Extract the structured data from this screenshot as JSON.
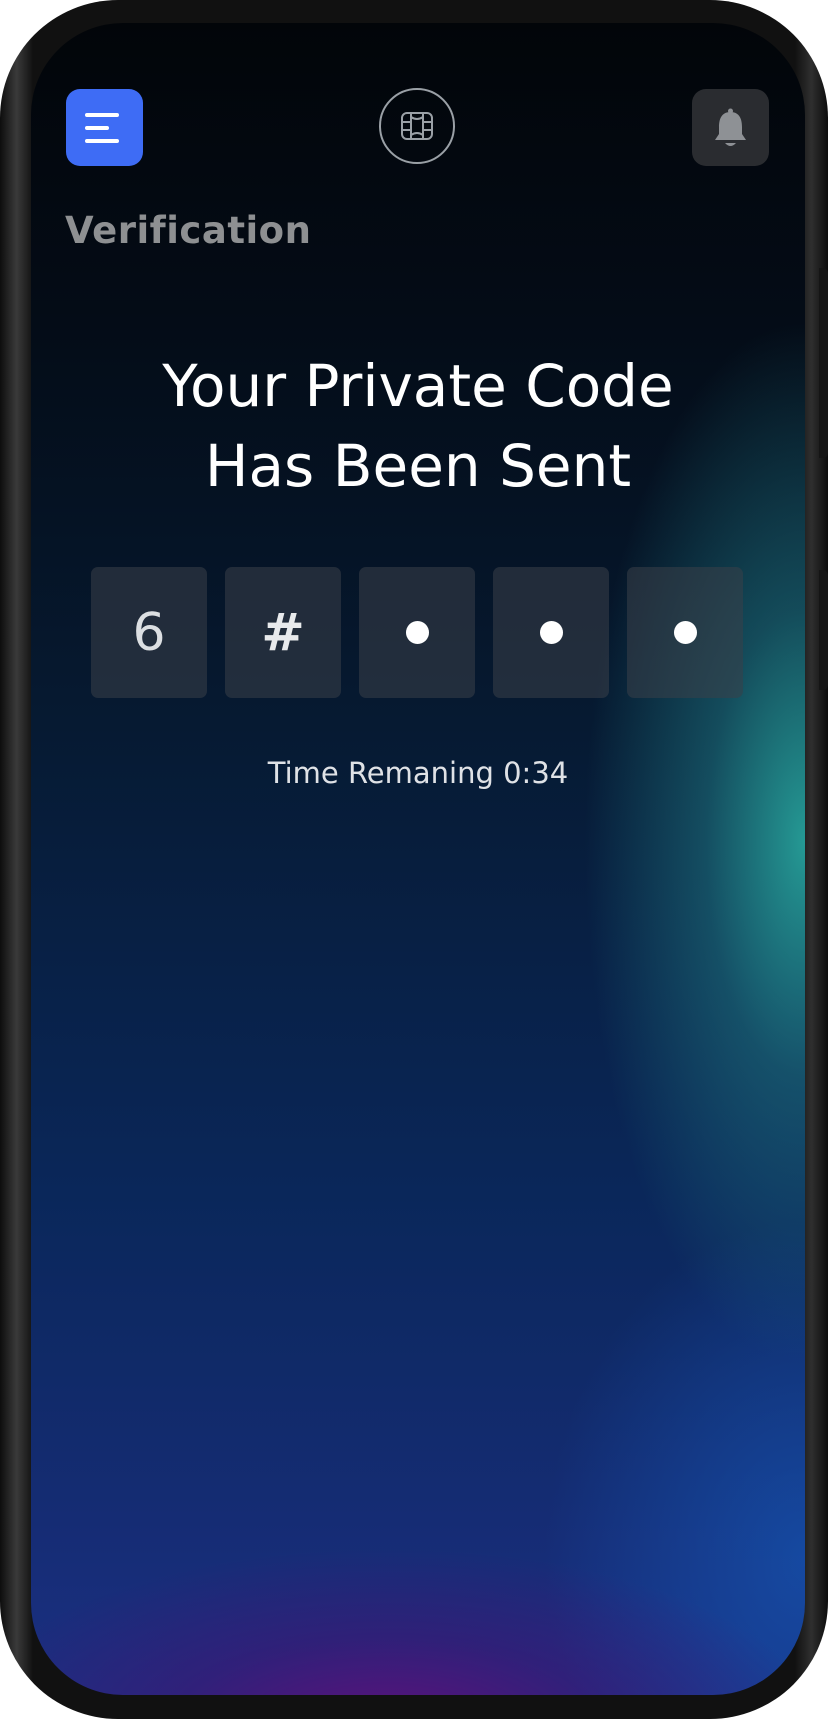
{
  "header": {
    "menu_icon": "menu-lines-icon",
    "logo_icon": "card-chip-icon",
    "notification_icon": "bell-icon",
    "accent_color": "#3e6cf5"
  },
  "page": {
    "title": "Verification"
  },
  "verification": {
    "headline_line1": "Your Private Code",
    "headline_line2": "Has Been Sent",
    "code_slots": [
      {
        "value": "6",
        "state": "entered"
      },
      {
        "value": "#",
        "state": "entered"
      },
      {
        "value": "",
        "state": "empty-dot"
      },
      {
        "value": "",
        "state": "empty-dot"
      },
      {
        "value": "",
        "state": "empty-dot"
      }
    ],
    "timer_text": "Time Remaning 0:34"
  }
}
